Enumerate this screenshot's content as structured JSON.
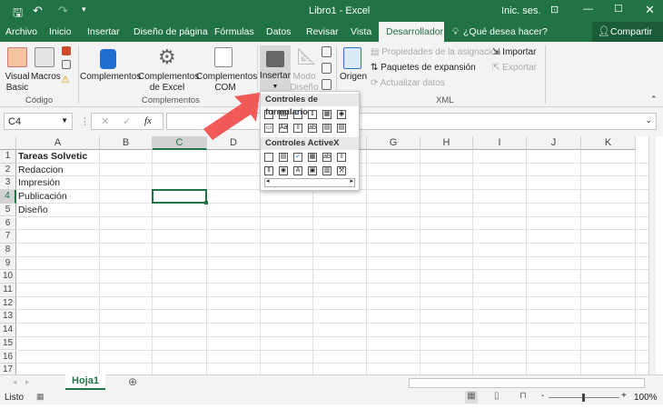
{
  "title_bar": {
    "title": "Libro1 - Excel",
    "signin": "Inic. ses.",
    "qat_icons": [
      "save-icon",
      "undo-icon",
      "redo-icon",
      "customize-icon"
    ]
  },
  "tabs": [
    "Archivo",
    "Inicio",
    "Insertar",
    "Diseño de página",
    "Fórmulas",
    "Datos",
    "Revisar",
    "Vista",
    "Desarrollador"
  ],
  "active_tab": "Desarrollador",
  "tell_me": "¿Qué desea hacer?",
  "share": "Compartir",
  "ribbon": {
    "codigo": {
      "label": "Código",
      "visual_basic": "Visual Basic",
      "macros": "Macros"
    },
    "complementos": {
      "label": "Complementos",
      "items": [
        "Complementos",
        "Complementos de Excel",
        "Complementos COM"
      ]
    },
    "controles": {
      "insertar": "Insertar",
      "modo_diseno": "Modo Diseño"
    },
    "xml": {
      "label": "XML",
      "origen": "Origen",
      "propiedades": "Propiedades de la asignación",
      "paquetes": "Paquetes de expansión",
      "actualizar": "Actualizar datos",
      "importar": "Importar",
      "exportar": "Exportar"
    }
  },
  "popup": {
    "form_header": "Controles de formulario",
    "activex_header": "Controles ActiveX"
  },
  "formula_bar": {
    "name_box": "C4",
    "value": "",
    "fx": "fx"
  },
  "columns": [
    "A",
    "B",
    "C",
    "D",
    "E",
    "F",
    "G",
    "H",
    "I",
    "J",
    "K"
  ],
  "rows": [
    "1",
    "2",
    "3",
    "4",
    "5",
    "6",
    "7",
    "8",
    "9",
    "10",
    "11",
    "12",
    "13",
    "14",
    "15",
    "16",
    "17"
  ],
  "cells": {
    "A1": "Tareas Solvetic",
    "A2": "Redaccion",
    "A3": "Impresión",
    "A4": "Publicación",
    "A5": "Diseño"
  },
  "selected_cell": "C4",
  "sheets": [
    "Hoja1"
  ],
  "status": {
    "ready": "Listo",
    "zoom": "100%"
  },
  "colors": {
    "accent": "#217346",
    "arrow": "#f25a5a"
  }
}
